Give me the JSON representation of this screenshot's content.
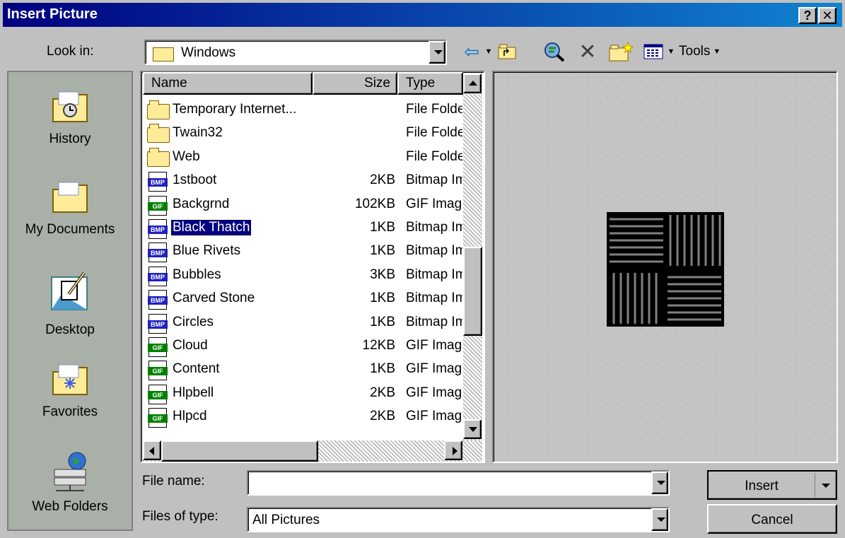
{
  "window": {
    "title": "Insert Picture",
    "help_glyph": "?",
    "close_glyph": "✕"
  },
  "lookin": {
    "label": "Look in:",
    "value": "Windows"
  },
  "toolbar": {
    "back_glyph": "⇦",
    "delete_glyph": "✕",
    "tools_label": "Tools"
  },
  "places": [
    {
      "label": "History",
      "icon": "history-folder-icon"
    },
    {
      "label": "My Documents",
      "icon": "my-documents-folder-icon"
    },
    {
      "label": "Desktop",
      "icon": "desktop-icon"
    },
    {
      "label": "Favorites",
      "icon": "favorites-folder-icon"
    },
    {
      "label": "Web Folders",
      "icon": "web-folders-icon"
    }
  ],
  "columns": {
    "name": "Name",
    "size": "Size",
    "type": "Type"
  },
  "files": [
    {
      "name": "Temporary Internet...",
      "size": "",
      "type": "File Folder",
      "kind": "folder"
    },
    {
      "name": "Twain32",
      "size": "",
      "type": "File Folder",
      "kind": "folder"
    },
    {
      "name": "Web",
      "size": "",
      "type": "File Folder",
      "kind": "folder"
    },
    {
      "name": "1stboot",
      "size": "2KB",
      "type": "Bitmap Image",
      "kind": "BMP"
    },
    {
      "name": "Backgrnd",
      "size": "102KB",
      "type": "GIF Image",
      "kind": "GIF"
    },
    {
      "name": "Black Thatch",
      "size": "1KB",
      "type": "Bitmap Image",
      "kind": "BMP",
      "selected": true
    },
    {
      "name": "Blue Rivets",
      "size": "1KB",
      "type": "Bitmap Image",
      "kind": "BMP"
    },
    {
      "name": "Bubbles",
      "size": "3KB",
      "type": "Bitmap Image",
      "kind": "BMP"
    },
    {
      "name": "Carved Stone",
      "size": "1KB",
      "type": "Bitmap Image",
      "kind": "BMP"
    },
    {
      "name": "Circles",
      "size": "1KB",
      "type": "Bitmap Image",
      "kind": "BMP"
    },
    {
      "name": "Cloud",
      "size": "12KB",
      "type": "GIF Image",
      "kind": "GIF"
    },
    {
      "name": "Content",
      "size": "1KB",
      "type": "GIF Image",
      "kind": "GIF"
    },
    {
      "name": "Hlpbell",
      "size": "2KB",
      "type": "GIF Image",
      "kind": "GIF"
    },
    {
      "name": "Hlpcd",
      "size": "2KB",
      "type": "GIF Image",
      "kind": "GIF"
    }
  ],
  "file_name": {
    "label": "File name:",
    "value": ""
  },
  "file_type": {
    "label": "Files of type:",
    "value": "All Pictures"
  },
  "buttons": {
    "insert": "Insert",
    "cancel": "Cancel"
  },
  "colors": {
    "bmp": "#2020c0",
    "gif": "#008000",
    "selection": "#000080"
  }
}
